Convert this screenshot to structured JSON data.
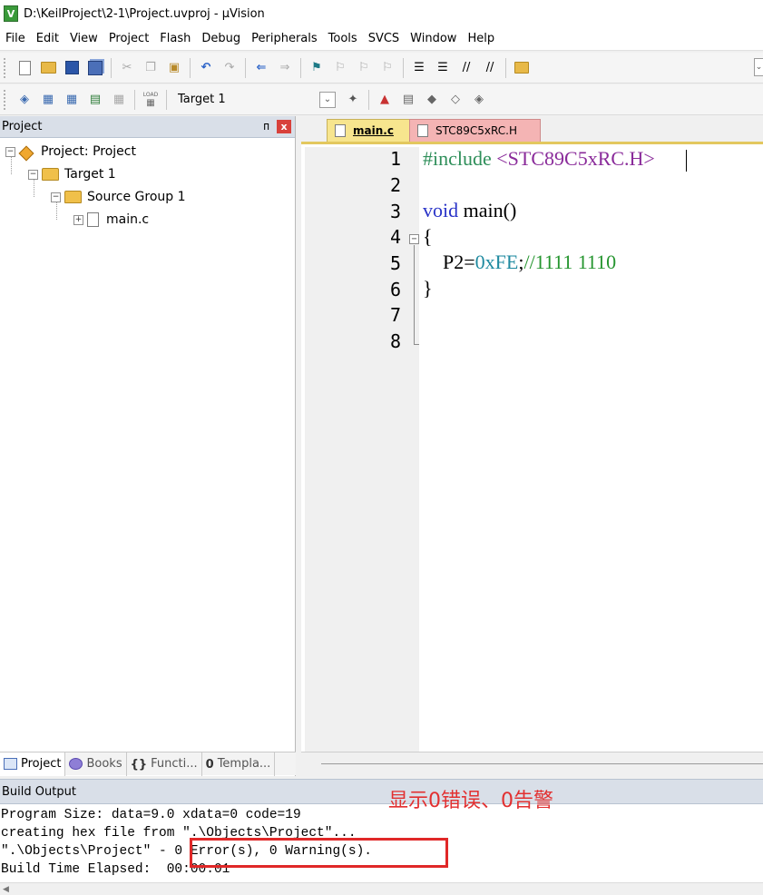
{
  "window": {
    "title": "D:\\KeilProject\\2-1\\Project.uvproj - µVision",
    "icon_letter": "V"
  },
  "menu": [
    "File",
    "Edit",
    "View",
    "Project",
    "Flash",
    "Debug",
    "Peripherals",
    "Tools",
    "SVCS",
    "Window",
    "Help"
  ],
  "toolbar": {
    "load_label": "LOAD",
    "target": "Target 1"
  },
  "project_panel": {
    "title": "Project",
    "pin": "ᴨ",
    "close": "x",
    "tree": {
      "root": "Project: Project",
      "target": "Target 1",
      "group": "Source Group 1",
      "file": "main.c"
    },
    "tabs": [
      {
        "label": "Project",
        "active": true
      },
      {
        "label": "Books",
        "active": false
      },
      {
        "label": "Functi...",
        "active": false
      },
      {
        "label": "Templa...",
        "active": false
      }
    ],
    "tab_braces": "{}",
    "tab_braces2": "0"
  },
  "editor": {
    "tabs": [
      {
        "label": "main.c",
        "active": true,
        "color": "#f7e58e"
      },
      {
        "label": "STC89C5xRC.H",
        "active": false,
        "color": "#f4b4b4"
      }
    ],
    "line_numbers": [
      "1",
      "2",
      "3",
      "4",
      "5",
      "6",
      "7",
      "8"
    ],
    "code": {
      "l1_pre": "#include ",
      "l1_hdr": "<STC89C5xRC.H>",
      "l3_kw": "void",
      "l3_rest": " main()",
      "l4": "{",
      "l5_a": "    P2=",
      "l5_num": "0xFE",
      "l5_b": ";",
      "l5_cmt": "//1111 1110",
      "l6": "}"
    }
  },
  "build_output": {
    "title": "Build Output",
    "lines": [
      "Program Size: data=9.0 xdata=0 code=19",
      "creating hex file from \".\\Objects\\Project\"...",
      "\".\\Objects\\Project\" - 0 Error(s), 0 Warning(s).",
      "Build Time Elapsed:  00:00:01"
    ],
    "annotation": "显示0错误、0告警",
    "annotation_color": "#e23030"
  }
}
